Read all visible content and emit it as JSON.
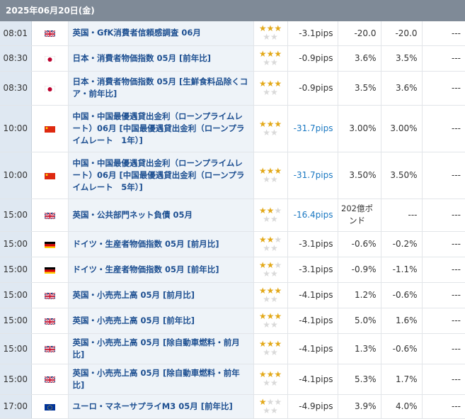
{
  "header": {
    "date": "2025年06月20日(金)"
  },
  "rows": [
    {
      "time": "08:01",
      "flag": "uk-flag-icon",
      "event": "英国・GfK消費者信頼感調査 06月",
      "stars": 3,
      "pips": "-3.1pips",
      "pips_blue": false,
      "previous": "-20.0",
      "forecast": "-20.0",
      "result": "---"
    },
    {
      "time": "08:30",
      "flag": "japan-flag-icon",
      "event": "日本・消費者物価指数 05月 [前年比]",
      "stars": 3,
      "pips": "-0.9pips",
      "pips_blue": false,
      "previous": "3.6%",
      "forecast": "3.5%",
      "result": "---"
    },
    {
      "time": "08:30",
      "flag": "japan-flag-icon",
      "event": "日本・消費者物価指数 05月 [生鮮食料品除くコア・前年比]",
      "stars": 3,
      "pips": "-0.9pips",
      "pips_blue": false,
      "previous": "3.5%",
      "forecast": "3.6%",
      "result": "---"
    },
    {
      "time": "10:00",
      "flag": "china-flag-icon",
      "event": "中国・中国最優遇貸出金利（ローンプライムレート）06月 [中国最優遇貸出金利（ローンプライムレート　1年）]",
      "stars": 3,
      "pips": "-31.7pips",
      "pips_blue": true,
      "previous": "3.00%",
      "forecast": "3.00%",
      "result": "---"
    },
    {
      "time": "10:00",
      "flag": "china-flag-icon",
      "event": "中国・中国最優遇貸出金利（ローンプライムレート）06月 [中国最優遇貸出金利（ローンプライムレート　5年）]",
      "stars": 3,
      "pips": "-31.7pips",
      "pips_blue": true,
      "previous": "3.50%",
      "forecast": "3.50%",
      "result": "---"
    },
    {
      "time": "15:00",
      "flag": "uk-flag-icon",
      "event": "英国・公共部門ネット負債 05月",
      "stars": 2,
      "pips": "-16.4pips",
      "pips_blue": true,
      "previous": "202億ポンド",
      "forecast": "---",
      "result": "---"
    },
    {
      "time": "15:00",
      "flag": "germany-flag-icon",
      "event": "ドイツ・生産者物価指数 05月 [前月比]",
      "stars": 2,
      "pips": "-3.1pips",
      "pips_blue": false,
      "previous": "-0.6%",
      "forecast": "-0.2%",
      "result": "---"
    },
    {
      "time": "15:00",
      "flag": "germany-flag-icon",
      "event": "ドイツ・生産者物価指数 05月 [前年比]",
      "stars": 2,
      "pips": "-3.1pips",
      "pips_blue": false,
      "previous": "-0.9%",
      "forecast": "-1.1%",
      "result": "---"
    },
    {
      "time": "15:00",
      "flag": "uk-flag-icon",
      "event": "英国・小売売上高 05月 [前月比]",
      "stars": 3,
      "pips": "-4.1pips",
      "pips_blue": false,
      "previous": "1.2%",
      "forecast": "-0.6%",
      "result": "---"
    },
    {
      "time": "15:00",
      "flag": "uk-flag-icon",
      "event": "英国・小売売上高 05月 [前年比]",
      "stars": 3,
      "pips": "-4.1pips",
      "pips_blue": false,
      "previous": "5.0%",
      "forecast": "1.6%",
      "result": "---"
    },
    {
      "time": "15:00",
      "flag": "uk-flag-icon",
      "event": "英国・小売売上高 05月 [除自動車燃料・前月比]",
      "stars": 3,
      "pips": "-4.1pips",
      "pips_blue": false,
      "previous": "1.3%",
      "forecast": "-0.6%",
      "result": "---"
    },
    {
      "time": "15:00",
      "flag": "uk-flag-icon",
      "event": "英国・小売売上高 05月 [除自動車燃料・前年比]",
      "stars": 3,
      "pips": "-4.1pips",
      "pips_blue": false,
      "previous": "5.3%",
      "forecast": "1.7%",
      "result": "---"
    },
    {
      "time": "17:00",
      "flag": "eu-flag-icon",
      "event": "ユーロ・マネーサプライM3 05月 [前年比]",
      "stars": 1,
      "pips": "-4.9pips",
      "pips_blue": false,
      "previous": "3.9%",
      "forecast": "4.0%",
      "result": "---"
    }
  ]
}
